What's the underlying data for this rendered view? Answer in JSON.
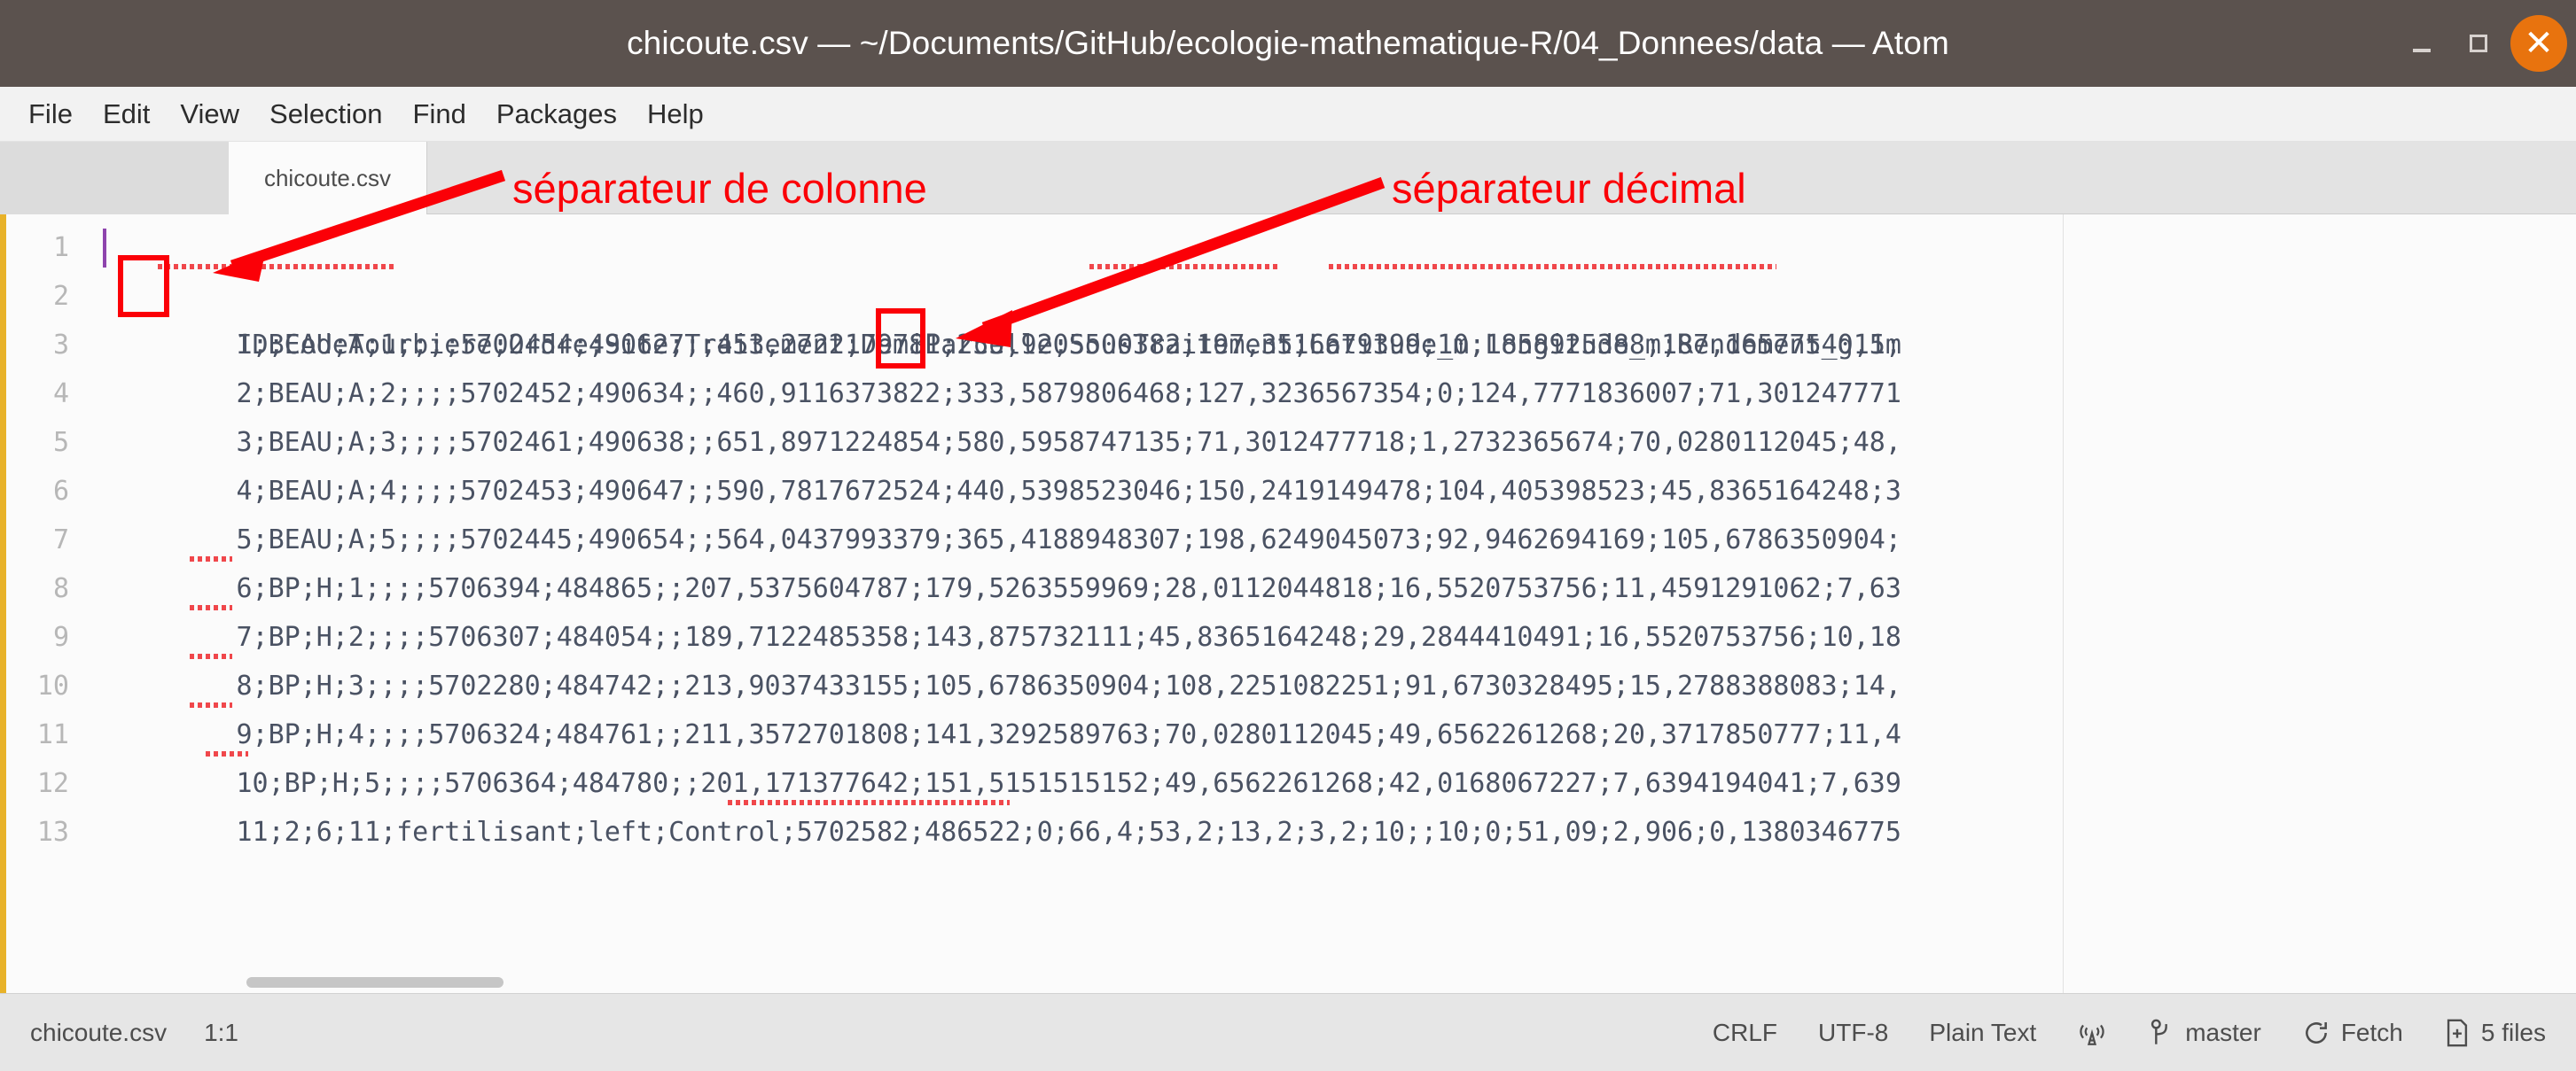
{
  "window": {
    "title": "chicoute.csv — ~/Documents/GitHub/ecologie-mathematique-R/04_Donnees/data — Atom",
    "minimize_label": "_",
    "maximize_label": "□",
    "close_label": "✕",
    "close_color": "#e8730e",
    "titlebar_color": "#5b524e"
  },
  "menubar": {
    "items": [
      {
        "label": "File"
      },
      {
        "label": "Edit"
      },
      {
        "label": "View"
      },
      {
        "label": "Selection"
      },
      {
        "label": "Find"
      },
      {
        "label": "Packages"
      },
      {
        "label": "Help"
      }
    ]
  },
  "tabs": [
    {
      "label": "chicoute.csv",
      "active": true
    }
  ],
  "editor": {
    "cursor_color": "#8e44ad",
    "accent_color": "#e8b229",
    "lines": [
      {
        "number": "1",
        "text": "ID;CodeTourbiere;Ordre;Site;Traitement;DemiParcelle;SousTraitement;Latitude_m;Longitude_m;Rendement_g,5m"
      },
      {
        "number": "2",
        "text": "1;BEAU;A;1;;;;5702454;490627;;453,2722179781;255,9205500382;197,3516679399;10,1858925388;187,1657754011;"
      },
      {
        "number": "3",
        "text": "2;BEAU;A;2;;;;5702452;490634;;460,9116373822;333,5879806468;127,3236567354;0;124,7771836007;71,301247771"
      },
      {
        "number": "4",
        "text": "3;BEAU;A;3;;;;5702461;490638;;651,8971224854;580,5958747135;71,3012477718;1,2732365674;70,0280112045;48,"
      },
      {
        "number": "5",
        "text": "4;BEAU;A;4;;;;5702453;490647;;590,7817672524;440,5398523046;150,2419149478;104,405398523;45,8365164248;3"
      },
      {
        "number": "6",
        "text": "5;BEAU;A;5;;;;5702445;490654;;564,0437993379;365,4188948307;198,6249045073;92,9462694169;105,6786350904;"
      },
      {
        "number": "7",
        "text": "6;BP;H;1;;;;5706394;484865;;207,5375604787;179,5263559969;28,0112044818;16,5520753756;11,4591291062;7,63"
      },
      {
        "number": "8",
        "text": "7;BP;H;2;;;;5706307;484054;;189,7122485358;143,875732111;45,8365164248;29,2844410491;16,5520753756;10,18"
      },
      {
        "number": "9",
        "text": "8;BP;H;3;;;;5702280;484742;;213,9037433155;105,6786350904;108,2251082251;91,6730328495;15,2788388083;14,"
      },
      {
        "number": "10",
        "text": "9;BP;H;4;;;;5706324;484761;;211,3572701808;141,3292589763;70,0280112045;49,6562261268;20,3717850777;11,4"
      },
      {
        "number": "11",
        "text": "10;BP;H;5;;;;5706364;484780;;201,171377642;151,5151515152;49,6562261268;42,0168067227;7,6394194041;7,639"
      },
      {
        "number": "12",
        "text": "11;2;6;11;fertilisant;left;Control;5702582;486522;0;66,4;53,2;13,2;3,2;10;;10;0;51,09;2,906;0,1380346775"
      },
      {
        "number": "13",
        "text": ""
      }
    ]
  },
  "annotations": {
    "color": "#fb0007",
    "column_separator_label": "séparateur de colonne",
    "decimal_separator_label": "séparateur décimal"
  },
  "statusbar": {
    "file_name": "chicoute.csv",
    "cursor_position": "1:1",
    "line_ending": "CRLF",
    "encoding": "UTF-8",
    "grammar": "Plain Text",
    "live_indicator": "live-server-icon",
    "branch": "master",
    "fetch": "Fetch",
    "changed_files": "5 files"
  }
}
